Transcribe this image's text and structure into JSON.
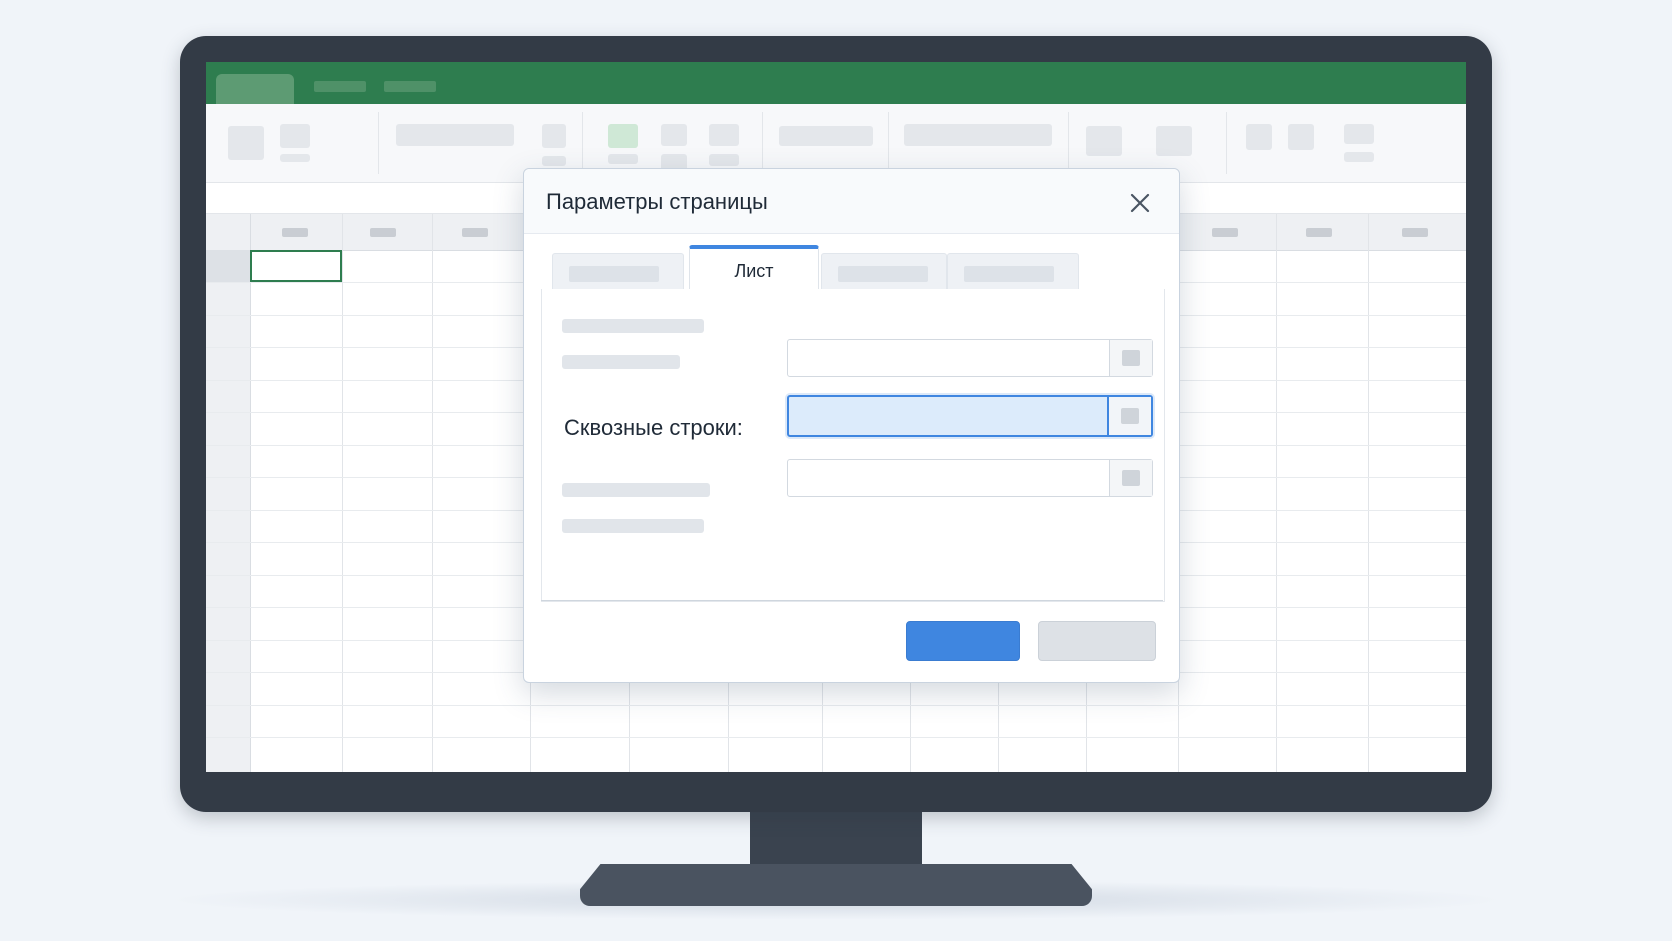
{
  "dialog": {
    "title": "Параметры страницы",
    "active_tab_label": "Лист",
    "field_label": "Сквозные строки:",
    "field_value": ""
  },
  "colors": {
    "app_accent": "#2e7d4f",
    "dialog_accent": "#3f86e0",
    "monitor_bezel": "#333b46"
  },
  "icons": {
    "close": "close-icon",
    "range_picker": "range-picker-icon"
  }
}
